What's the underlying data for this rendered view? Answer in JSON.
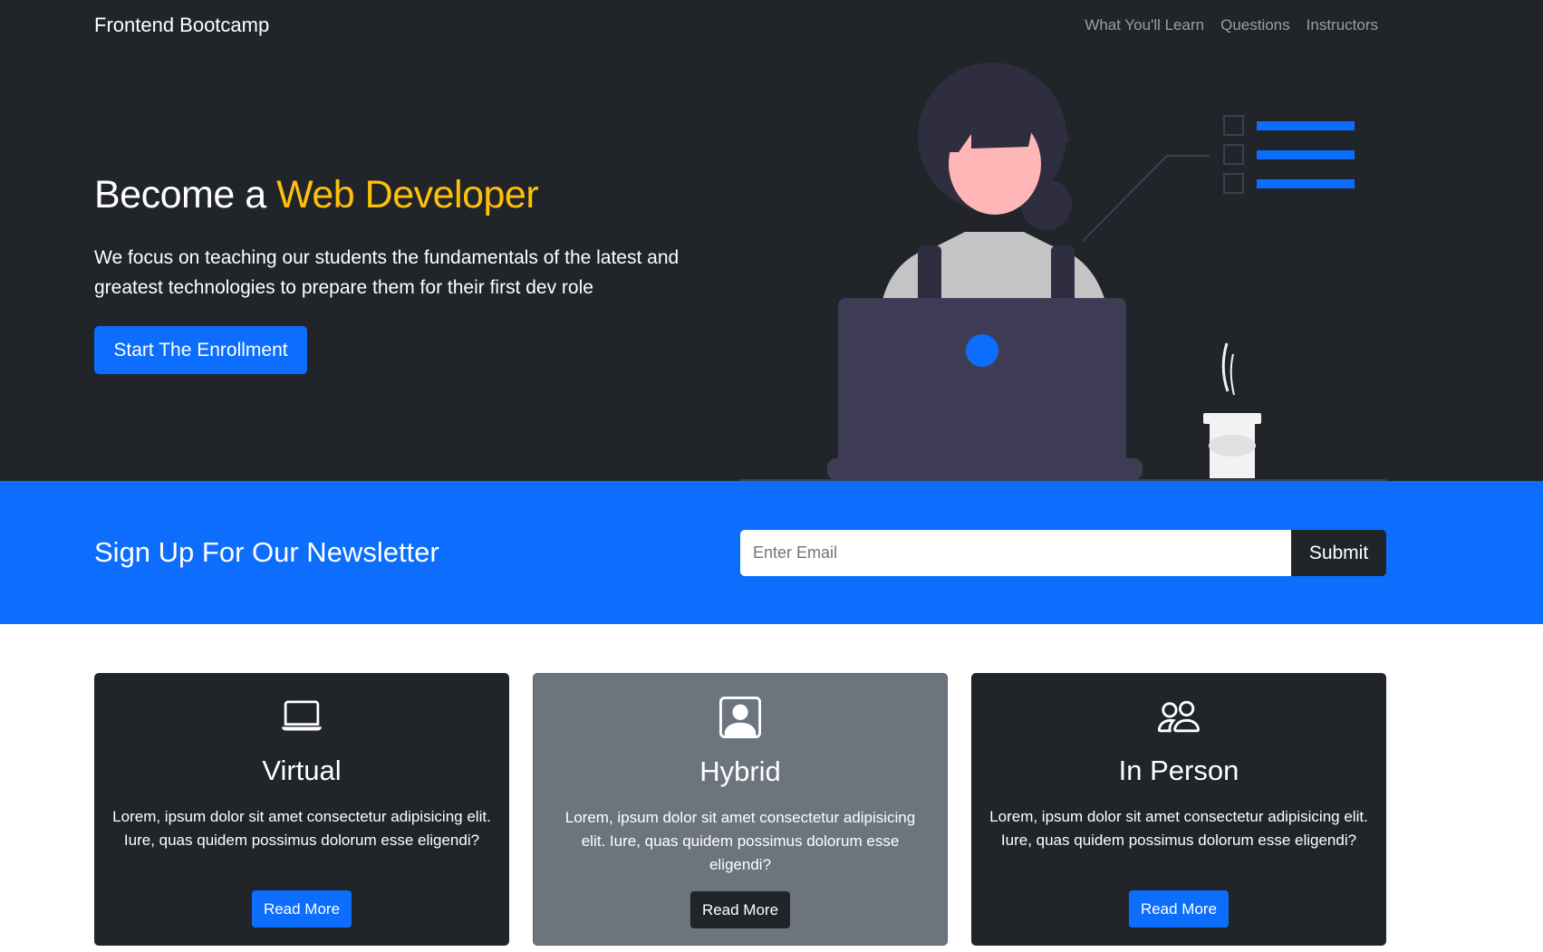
{
  "navbar": {
    "brand": "Frontend Bootcamp",
    "links": [
      "What You'll Learn",
      "Questions",
      "Instructors"
    ]
  },
  "hero": {
    "title_prefix": "Become a ",
    "title_accent": "Web Developer",
    "lead": "We focus on teaching our students the fundamentals of the latest and greatest technologies to prepare them for their first dev role",
    "button": "Start The Enrollment"
  },
  "newsletter": {
    "title": "Sign Up For Our Newsletter",
    "placeholder": "Enter Email",
    "submit": "Submit"
  },
  "cards": [
    {
      "icon": "laptop-icon",
      "title": "Virtual",
      "text": "Lorem, ipsum dolor sit amet consectetur adipisicing elit. Iure, quas quidem possimus dolorum esse eligendi?",
      "button": "Read More"
    },
    {
      "icon": "person-square-icon",
      "title": "Hybrid",
      "text": "Lorem, ipsum dolor sit amet consectetur adipisicing elit. Iure, quas quidem possimus dolorum esse eligendi?",
      "button": "Read More"
    },
    {
      "icon": "people-icon",
      "title": "In Person",
      "text": "Lorem, ipsum dolor sit amet consectetur adipisicing elit. Iure, quas quidem possimus dolorum esse eligendi?",
      "button": "Read More"
    }
  ],
  "colors": {
    "dark": "#212529",
    "primary": "#0d6efd",
    "accent": "#ffc107",
    "secondary": "#6c757d"
  }
}
